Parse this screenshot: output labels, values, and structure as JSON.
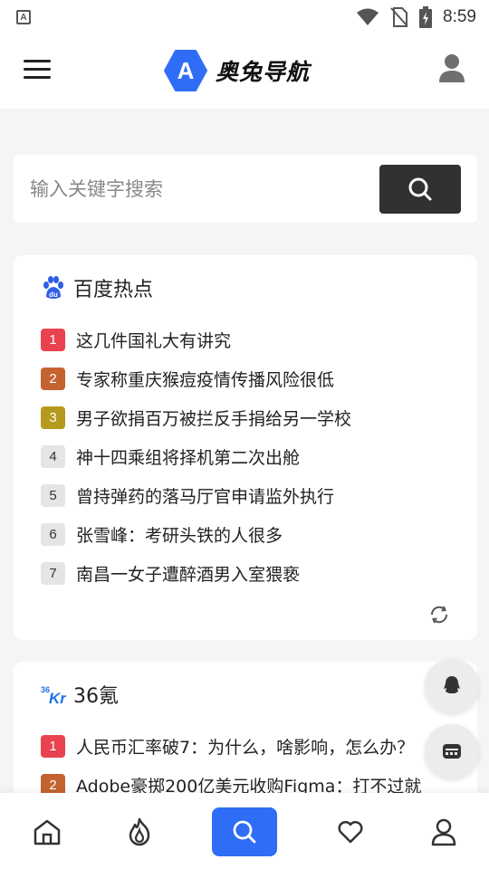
{
  "status_bar": {
    "time": "8:59",
    "app_indicator": "A",
    "icons": [
      "wifi-icon",
      "no-sim-icon",
      "battery-charging-icon"
    ]
  },
  "header": {
    "brand_title": "奥兔导航",
    "logo_letter": "A",
    "logo_color": "#2f6df6",
    "icons": [
      "menu-icon",
      "user-icon"
    ]
  },
  "search": {
    "placeholder": "输入关键字搜索",
    "value": ""
  },
  "baidu": {
    "title": "百度热点",
    "items": [
      {
        "rank": "1",
        "text": "这几件国礼大有讲究"
      },
      {
        "rank": "2",
        "text": "专家称重庆猴痘疫情传播风险很低"
      },
      {
        "rank": "3",
        "text": "男子欲捐百万被拦反手捐给另一学校"
      },
      {
        "rank": "4",
        "text": "神十四乘组将择机第二次出舱"
      },
      {
        "rank": "5",
        "text": "曾持弹药的落马厅官申请监外执行"
      },
      {
        "rank": "6",
        "text": "张雪峰：考研头铁的人很多"
      },
      {
        "rank": "7",
        "text": "南昌一女子遭醉酒男入室猥亵"
      }
    ]
  },
  "kr36": {
    "title": "36氪",
    "logo_text": "Kr",
    "logo_sup": "36",
    "items": [
      {
        "rank": "1",
        "text": "人民币汇率破7：为什么，啥影响，怎么办？"
      },
      {
        "rank": "2",
        "text": "Adobe豪掷200亿美元收购Figma：打不过就"
      }
    ]
  },
  "rank_colors": {
    "1": "#e8434e",
    "2": "#c4632f",
    "3": "#b59a1d",
    "other": "#e4e5e7"
  },
  "floating_buttons": [
    "qq-icon",
    "card-icon"
  ],
  "bottom_nav": {
    "items": [
      "home-icon",
      "hot-icon",
      "search-icon",
      "favorite-icon",
      "profile-icon"
    ],
    "active": "search-icon",
    "accent": "#2f6df6"
  }
}
